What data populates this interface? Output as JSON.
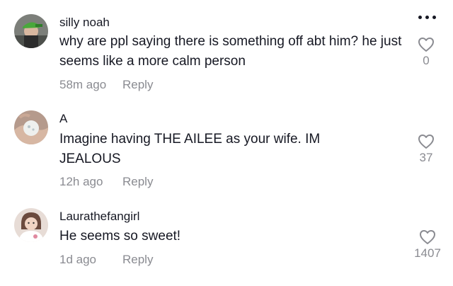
{
  "comments": [
    {
      "username": "silly noah",
      "text": "why are ppl saying there is something off abt him? he just seems like a more calm person",
      "time": "58m ago",
      "reply_label": "Reply",
      "likes": "0",
      "avatar_icon": "profile-photo-green-cap"
    },
    {
      "username": "A",
      "text": "Imagine having THE AILEE as your wife. IM JEALOUS",
      "time": "12h ago",
      "reply_label": "Reply",
      "likes": "37",
      "avatar_icon": "profile-photo-hand-ball"
    },
    {
      "username": "Laurathefangirl",
      "text": "He seems so sweet!",
      "time": "1d ago",
      "reply_label": "Reply",
      "likes": "1407",
      "avatar_icon": "profile-photo-person"
    }
  ],
  "colors": {
    "text": "#161823",
    "secondary": "#8a8b91",
    "background": "#ffffff"
  },
  "icons": {
    "more": "more-options-icon",
    "like": "heart-outline-icon"
  }
}
